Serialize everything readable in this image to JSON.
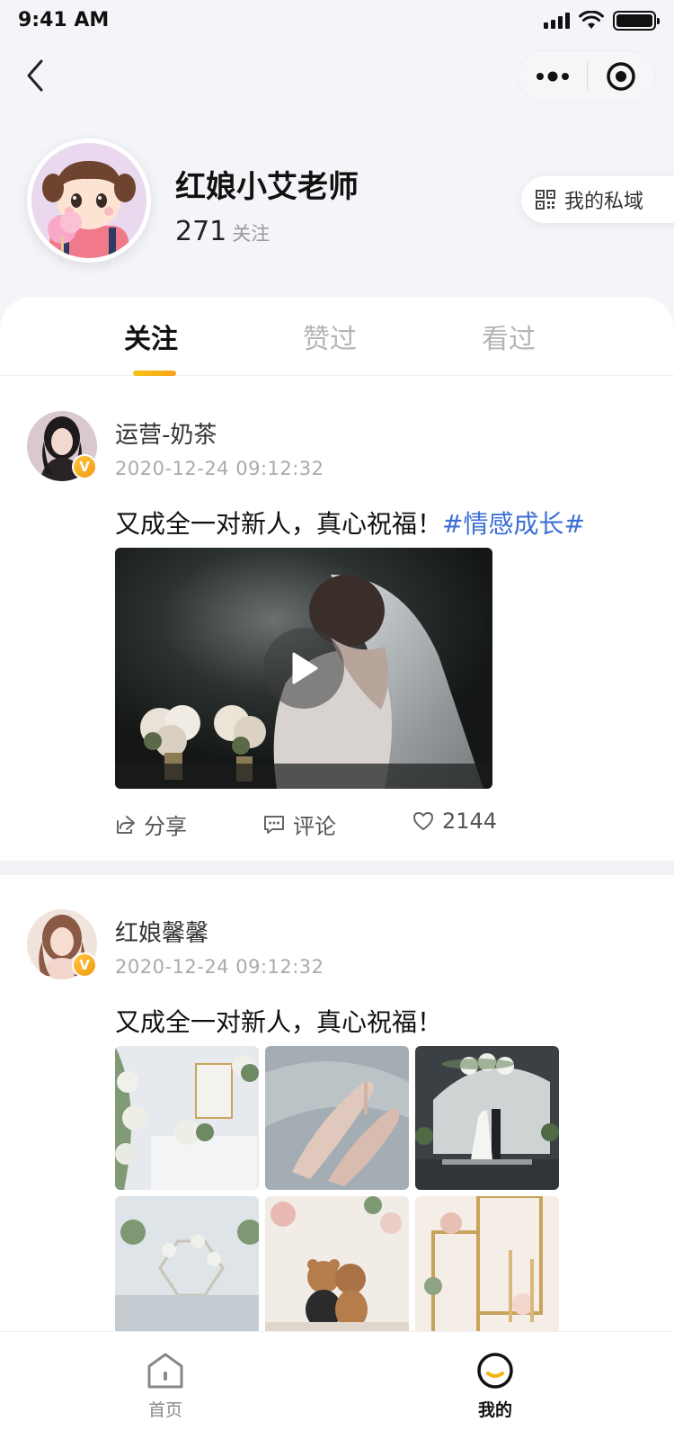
{
  "status_bar": {
    "time": "9:41 AM"
  },
  "profile": {
    "name": "红娘小艾老师",
    "follow_count": "271",
    "follow_label": "关注",
    "private_domain_label": "我的私域"
  },
  "tabs": [
    {
      "label": "关注",
      "active": true
    },
    {
      "label": "赞过",
      "active": false
    },
    {
      "label": "看过",
      "active": false
    }
  ],
  "posts": [
    {
      "author": "运营-奶茶",
      "time": "2020-12-24  09:12:32",
      "text": "又成全一对新人，真心祝福！",
      "tag": "#情感成长#",
      "media": "video",
      "actions": {
        "share": "分享",
        "comment": "评论",
        "likes": "2144"
      }
    },
    {
      "author": "红娘馨馨",
      "time": "2020-12-24  09:12:32",
      "text": "又成全一对新人，真心祝福！",
      "media": "images",
      "image_count": 6
    }
  ],
  "verified_badge": "V",
  "bottom_nav": [
    {
      "label": "首页",
      "icon": "home-icon",
      "active": false
    },
    {
      "label": "我的",
      "icon": "profile-icon",
      "active": true
    }
  ],
  "colors": {
    "accent": "#f6a21a",
    "tag": "#3c6fd6",
    "background": "#f3f5f8"
  }
}
